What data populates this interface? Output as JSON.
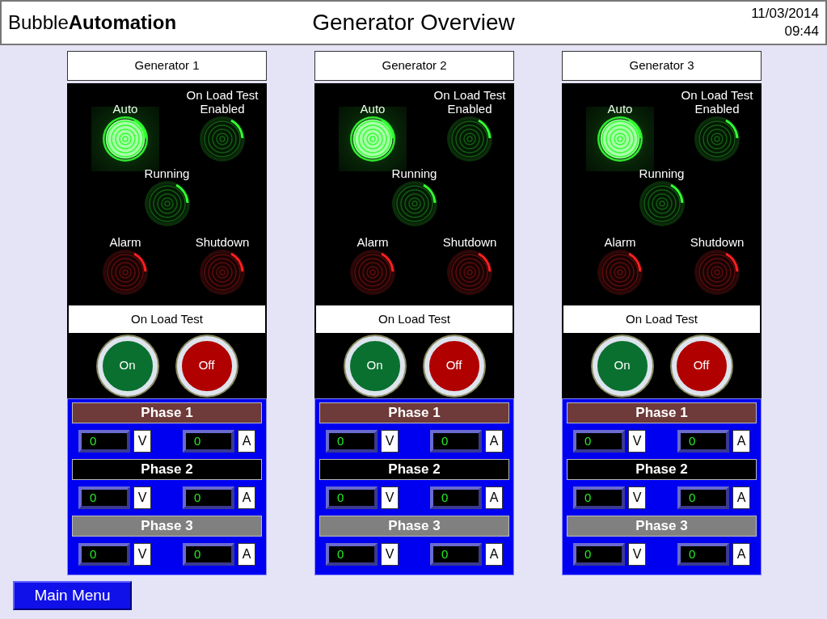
{
  "header": {
    "brand_light": "Bubble",
    "brand_bold": "Automation",
    "title": "Generator Overview",
    "date": "11/03/2014",
    "time": "09:44"
  },
  "generators": [
    {
      "name": "Generator 1",
      "lamps": [
        {
          "label": "Auto",
          "on": true,
          "color": "#33ff33"
        },
        {
          "label": "On Load Test Enabled",
          "on": false,
          "color": "#33ff33"
        },
        {
          "label": "Running",
          "on": false,
          "color": "#33ff33"
        },
        {
          "label": "Alarm",
          "on": false,
          "color": "#ff2020"
        },
        {
          "label": "Shutdown",
          "on": false,
          "color": "#ff2020"
        }
      ],
      "test_label": "On Load Test",
      "buttons": [
        {
          "label": "On",
          "color": "#0a7030"
        },
        {
          "label": "Off",
          "color": "#b00000"
        }
      ],
      "phases": [
        {
          "name": "Phase 1",
          "color": "#6e3a3a",
          "volts": "0",
          "volt_unit": "V",
          "amps": "0",
          "amp_unit": "A"
        },
        {
          "name": "Phase 2",
          "color": "#000000",
          "volts": "0",
          "volt_unit": "V",
          "amps": "0",
          "amp_unit": "A"
        },
        {
          "name": "Phase 3",
          "color": "#808080",
          "volts": "0",
          "volt_unit": "V",
          "amps": "0",
          "amp_unit": "A"
        }
      ]
    },
    {
      "name": "Generator 2",
      "lamps": [
        {
          "label": "Auto",
          "on": true,
          "color": "#33ff33"
        },
        {
          "label": "On Load Test Enabled",
          "on": false,
          "color": "#33ff33"
        },
        {
          "label": "Running",
          "on": false,
          "color": "#33ff33"
        },
        {
          "label": "Alarm",
          "on": false,
          "color": "#ff2020"
        },
        {
          "label": "Shutdown",
          "on": false,
          "color": "#ff2020"
        }
      ],
      "test_label": "On Load Test",
      "buttons": [
        {
          "label": "On",
          "color": "#0a7030"
        },
        {
          "label": "Off",
          "color": "#b00000"
        }
      ],
      "phases": [
        {
          "name": "Phase 1",
          "color": "#6e3a3a",
          "volts": "0",
          "volt_unit": "V",
          "amps": "0",
          "amp_unit": "A"
        },
        {
          "name": "Phase 2",
          "color": "#000000",
          "volts": "0",
          "volt_unit": "V",
          "amps": "0",
          "amp_unit": "A"
        },
        {
          "name": "Phase 3",
          "color": "#808080",
          "volts": "0",
          "volt_unit": "V",
          "amps": "0",
          "amp_unit": "A"
        }
      ]
    },
    {
      "name": "Generator 3",
      "lamps": [
        {
          "label": "Auto",
          "on": true,
          "color": "#33ff33"
        },
        {
          "label": "On Load Test Enabled",
          "on": false,
          "color": "#33ff33"
        },
        {
          "label": "Running",
          "on": false,
          "color": "#33ff33"
        },
        {
          "label": "Alarm",
          "on": false,
          "color": "#ff2020"
        },
        {
          "label": "Shutdown",
          "on": false,
          "color": "#ff2020"
        }
      ],
      "test_label": "On Load Test",
      "buttons": [
        {
          "label": "On",
          "color": "#0a7030"
        },
        {
          "label": "Off",
          "color": "#b00000"
        }
      ],
      "phases": [
        {
          "name": "Phase 1",
          "color": "#6e3a3a",
          "volts": "0",
          "volt_unit": "V",
          "amps": "0",
          "amp_unit": "A"
        },
        {
          "name": "Phase 2",
          "color": "#000000",
          "volts": "0",
          "volt_unit": "V",
          "amps": "0",
          "amp_unit": "A"
        },
        {
          "name": "Phase 3",
          "color": "#808080",
          "volts": "0",
          "volt_unit": "V",
          "amps": "0",
          "amp_unit": "A"
        }
      ]
    }
  ],
  "main_menu": "Main Menu"
}
